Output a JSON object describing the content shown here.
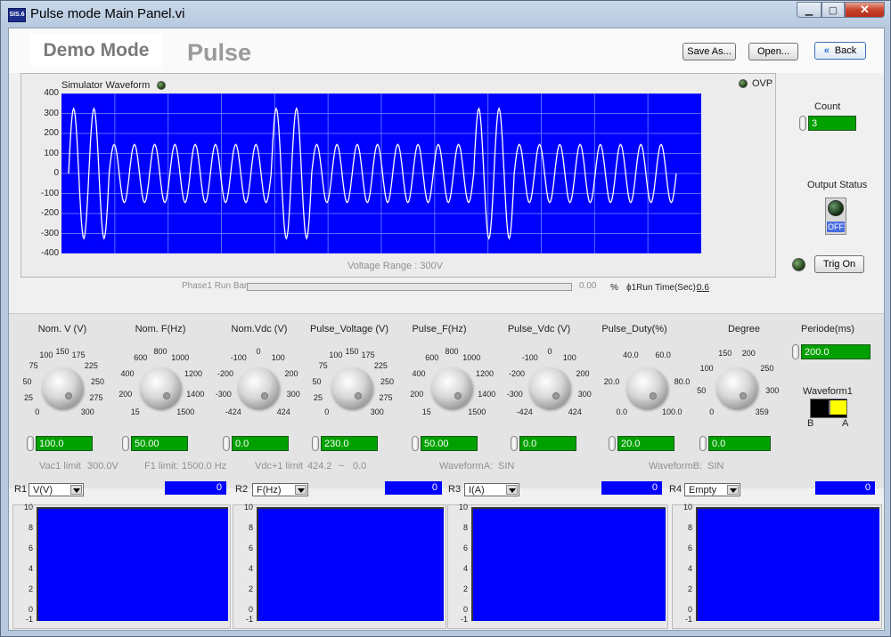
{
  "window": {
    "title": "Pulse mode Main Panel.vi",
    "icon_text": "SIS.6"
  },
  "header": {
    "mode": "Demo Mode",
    "title": "Pulse",
    "save_as": "Save As...",
    "open": "Open...",
    "back": "Back"
  },
  "waveform": {
    "label": "Simulator Waveform",
    "ovp_label": "OVP",
    "range_text": "Voltage Range : 300V",
    "chart_data": {
      "type": "line",
      "title": "Simulator Waveform",
      "ylim": [
        -400,
        400
      ],
      "y_ticks": [
        400,
        300,
        200,
        100,
        0,
        -100,
        -200,
        -300,
        -400
      ],
      "series": [
        {
          "name": "",
          "segments": [
            {
              "cycles": 2,
              "amplitude": 325
            },
            {
              "cycles": 8,
              "amplitude": 145
            },
            {
              "cycles": 2,
              "amplitude": 325
            },
            {
              "cycles": 8,
              "amplitude": 145
            },
            {
              "cycles": 2,
              "amplitude": 325
            },
            {
              "cycles": 8,
              "amplitude": 145
            }
          ]
        }
      ]
    }
  },
  "runbar": {
    "label": "Phase1 Run Bar",
    "value": "0.00",
    "percent": "%",
    "run_time_label": "ϕ1Run Time(Sec):",
    "run_time": "0.6",
    "progress": 0
  },
  "right": {
    "count_label": "Count",
    "count": "3",
    "output_status_label": "Output Status",
    "output_state": "OFF",
    "trig_on": "Trig On"
  },
  "knobs": [
    {
      "label": "Nom. V (V)",
      "ticks": [
        "0",
        "25",
        "50",
        "75",
        "100",
        "150",
        "175",
        "225",
        "250",
        "275",
        "300"
      ],
      "value": "100.0"
    },
    {
      "label": "Nom. F(Hz)",
      "ticks": [
        "15",
        "200",
        "400",
        "600",
        "800",
        "1000",
        "1200",
        "1400",
        "1500"
      ],
      "value": "50.00"
    },
    {
      "label": "Nom.Vdc (V)",
      "ticks": [
        "-424",
        "-300",
        "-200",
        "-100",
        "0",
        "100",
        "200",
        "300",
        "424"
      ],
      "value": "0.0"
    },
    {
      "label": "Pulse_Voltage (V)",
      "ticks": [
        "0",
        "25",
        "50",
        "75",
        "100",
        "150",
        "175",
        "225",
        "250",
        "275",
        "300"
      ],
      "value": "230.0"
    },
    {
      "label": "Pulse_F(Hz)",
      "ticks": [
        "15",
        "200",
        "400",
        "600",
        "800",
        "1000",
        "1200",
        "1400",
        "1500"
      ],
      "value": "50.00"
    },
    {
      "label": "Pulse_Vdc (V)",
      "ticks": [
        "-424",
        "-300",
        "-200",
        "-100",
        "0",
        "100",
        "200",
        "300",
        "424"
      ],
      "value": "0.0"
    },
    {
      "label": "Pulse_Duty(%)",
      "ticks": [
        "0.0",
        "20.0",
        "40.0",
        "60.0",
        "80.0",
        "100.0"
      ],
      "value": "20.0"
    },
    {
      "label": "Degree",
      "ticks": [
        "0",
        "50",
        "100",
        "150",
        "200",
        "250",
        "300",
        "359"
      ],
      "value": "0.0"
    }
  ],
  "periode": {
    "label": "Periode(ms)",
    "value": "200.0"
  },
  "waveform1": {
    "label": "Waveform1",
    "b": "B",
    "a": "A"
  },
  "limits": {
    "vac1": "Vac1 limit",
    "vac1_val": "300.0V",
    "f1": "F1 limit:",
    "f1_val": "1500.0 Hz",
    "vdc1": "Vdc+1 limit",
    "vdc1_val": "424.2",
    "tilde": "~",
    "vdc1_min": "0.0",
    "wa": "WaveformA:",
    "wa_val": "SIN",
    "wb": "WaveformB:",
    "wb_val": "SIN"
  },
  "readouts": [
    {
      "name": "R1",
      "select": "V(V)",
      "value": "0"
    },
    {
      "name": "R2",
      "select": "F(Hz)",
      "value": "0"
    },
    {
      "name": "R3",
      "select": "I(A)",
      "value": "0"
    },
    {
      "name": "R4",
      "select": "Empty",
      "value": "0"
    }
  ],
  "mini_ticks": [
    "10",
    "8",
    "6",
    "4",
    "2",
    "0",
    "-1"
  ]
}
